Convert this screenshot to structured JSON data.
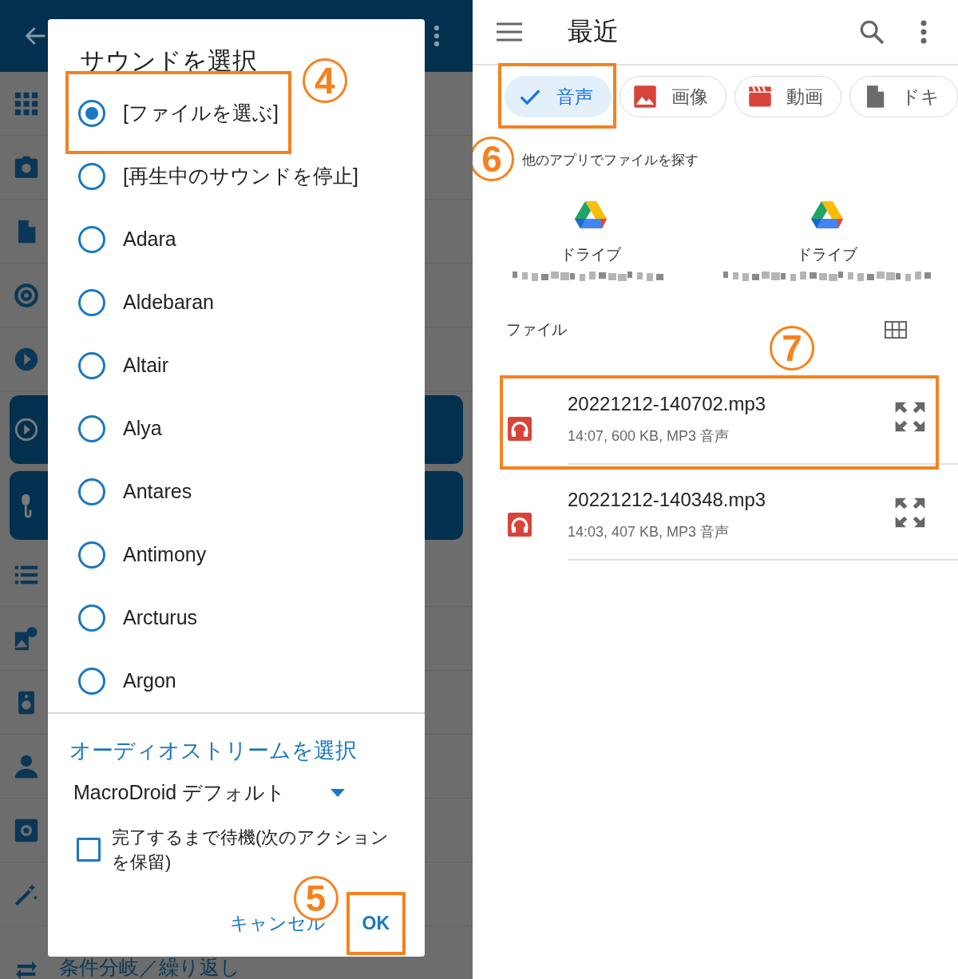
{
  "background_app": {
    "rows": [
      {
        "highlighted": false
      },
      {
        "highlighted": false
      },
      {
        "highlighted": false
      },
      {
        "highlighted": false
      },
      {
        "highlighted": false
      },
      {
        "highlighted": true
      },
      {
        "highlighted": true
      },
      {
        "highlighted": false
      },
      {
        "highlighted": false
      },
      {
        "highlighted": false
      },
      {
        "highlighted": false
      },
      {
        "highlighted": false
      },
      {
        "highlighted": false
      },
      {
        "highlighted": false,
        "label": "条件分岐／繰り返し"
      }
    ]
  },
  "sound_dialog": {
    "title": "サウンドを選択",
    "options": [
      {
        "label": "[ファイルを選ぶ]",
        "selected": true,
        "highlighted": true,
        "callout": "4"
      },
      {
        "label": "[再生中のサウンドを停止]",
        "selected": false,
        "highlighted": false
      },
      {
        "label": "Adara",
        "selected": false,
        "highlighted": false
      },
      {
        "label": "Aldebaran",
        "selected": false,
        "highlighted": false
      },
      {
        "label": "Altair",
        "selected": false,
        "highlighted": false
      },
      {
        "label": "Alya",
        "selected": false,
        "highlighted": false
      },
      {
        "label": "Antares",
        "selected": false,
        "highlighted": false
      },
      {
        "label": "Antimony",
        "selected": false,
        "highlighted": false
      },
      {
        "label": "Arcturus",
        "selected": false,
        "highlighted": false
      },
      {
        "label": "Argon",
        "selected": false,
        "highlighted": false
      }
    ],
    "stream_label": "オーディオストリームを選択",
    "stream_value": "MacroDroid デフォルト",
    "wait": {
      "label": "完了するまで待機(次のアクションを保留)",
      "checked": false
    },
    "buttons": [
      {
        "label": "キャンセル",
        "highlighted": false
      },
      {
        "label": "OK",
        "highlighted": true,
        "callout": "5"
      }
    ]
  },
  "file_picker": {
    "title": "最近",
    "chips": [
      {
        "label": "音声",
        "kind": "audio",
        "selected": true,
        "highlighted": true,
        "callout": "6"
      },
      {
        "label": "画像",
        "kind": "image",
        "selected": false,
        "highlighted": false
      },
      {
        "label": "動画",
        "kind": "video",
        "selected": false,
        "highlighted": false
      },
      {
        "label": "ドキ",
        "kind": "document",
        "selected": false,
        "highlighted": false
      }
    ],
    "other_apps_heading": "他のアプリでファイルを探す",
    "apps": [
      {
        "label": "ドライブ",
        "account_redacted": true
      },
      {
        "label": "ドライブ",
        "account_redacted": true
      }
    ],
    "files_heading": "ファイル",
    "files_callout": "7",
    "files": [
      {
        "name": "20221212-140702.mp3",
        "details": "14:07, 600 KB, MP3 音声",
        "highlighted": true
      },
      {
        "name": "20221212-140348.mp3",
        "details": "14:03, 407 KB, MP3 音声",
        "highlighted": false
      }
    ]
  }
}
